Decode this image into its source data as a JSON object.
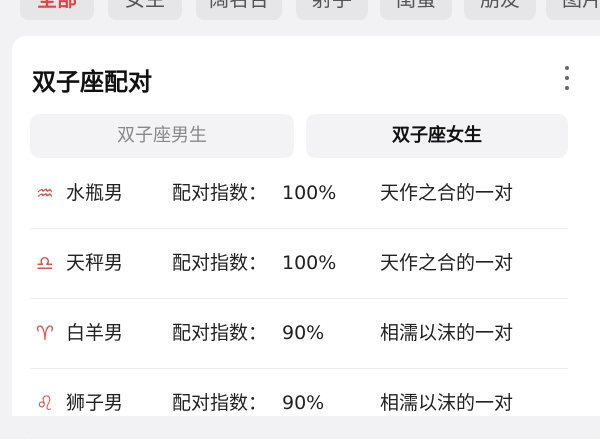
{
  "filters": [
    {
      "label": "全部",
      "active": true
    },
    {
      "label": "女主",
      "active": false
    },
    {
      "label": "阔名台",
      "active": false
    },
    {
      "label": "射手",
      "active": false
    },
    {
      "label": "闺蜜",
      "active": false
    },
    {
      "label": "朋友",
      "active": false
    },
    {
      "label": "图片",
      "active": false
    }
  ],
  "card": {
    "title": "双子座配对",
    "tabs": [
      {
        "label": "双子座男生",
        "active": false
      },
      {
        "label": "双子座女生",
        "active": true
      }
    ],
    "rows": [
      {
        "icon": "aquarius-icon",
        "symbol": "♒",
        "name": "水瓶男",
        "label": "配对指数：",
        "score": "100%",
        "desc": "天作之合的一对"
      },
      {
        "icon": "libra-icon",
        "symbol": "♎",
        "name": "天秤男",
        "label": "配对指数：",
        "score": "100%",
        "desc": "天作之合的一对"
      },
      {
        "icon": "aries-icon",
        "symbol": "♈",
        "name": "白羊男",
        "label": "配对指数：",
        "score": "90%",
        "desc": "相濡以沫的一对"
      },
      {
        "icon": "leo-icon",
        "symbol": "♌",
        "name": "狮子男",
        "label": "配对指数：",
        "score": "90%",
        "desc": "相濡以沫的一对"
      }
    ]
  },
  "colors": {
    "accent": "#d9534f",
    "background": "#f2f2f4",
    "card": "#ffffff"
  }
}
